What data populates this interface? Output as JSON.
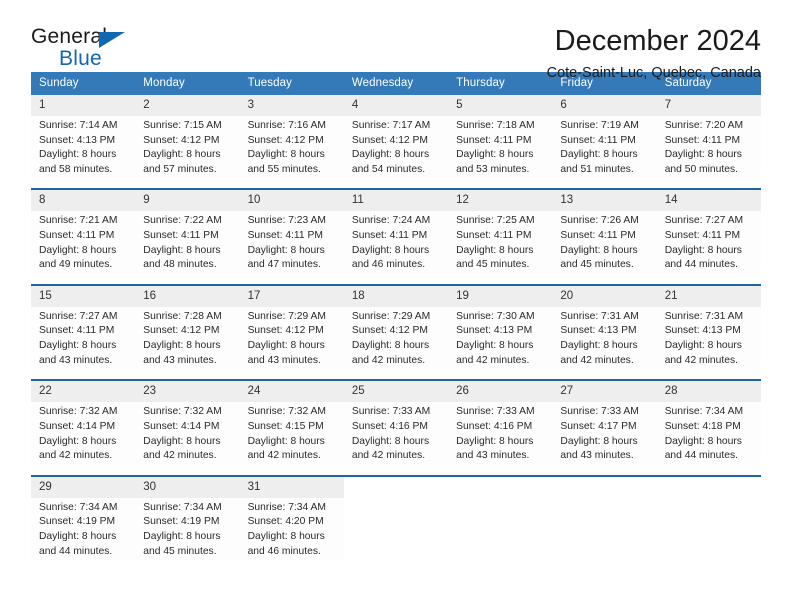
{
  "brand": {
    "word_one": "General",
    "word_two": "Blue",
    "triangle_icon": "triangle-icon"
  },
  "header": {
    "title": "December 2024",
    "location": "Cote-Saint-Luc, Quebec, Canada"
  },
  "colors": {
    "header_blue": "#3479b8",
    "separator_blue": "#1f64a5",
    "daynum_band": "#eeeeee",
    "brand_blue": "#1267b1",
    "text": "#222222"
  },
  "weekday_headers": [
    "Sunday",
    "Monday",
    "Tuesday",
    "Wednesday",
    "Thursday",
    "Friday",
    "Saturday"
  ],
  "weeks": [
    {
      "days": [
        {
          "date": "1",
          "sunrise": "Sunrise: 7:14 AM",
          "sunset": "Sunset: 4:13 PM",
          "daylight_1": "Daylight: 8 hours",
          "daylight_2": "and 58 minutes."
        },
        {
          "date": "2",
          "sunrise": "Sunrise: 7:15 AM",
          "sunset": "Sunset: 4:12 PM",
          "daylight_1": "Daylight: 8 hours",
          "daylight_2": "and 57 minutes."
        },
        {
          "date": "3",
          "sunrise": "Sunrise: 7:16 AM",
          "sunset": "Sunset: 4:12 PM",
          "daylight_1": "Daylight: 8 hours",
          "daylight_2": "and 55 minutes."
        },
        {
          "date": "4",
          "sunrise": "Sunrise: 7:17 AM",
          "sunset": "Sunset: 4:12 PM",
          "daylight_1": "Daylight: 8 hours",
          "daylight_2": "and 54 minutes."
        },
        {
          "date": "5",
          "sunrise": "Sunrise: 7:18 AM",
          "sunset": "Sunset: 4:11 PM",
          "daylight_1": "Daylight: 8 hours",
          "daylight_2": "and 53 minutes."
        },
        {
          "date": "6",
          "sunrise": "Sunrise: 7:19 AM",
          "sunset": "Sunset: 4:11 PM",
          "daylight_1": "Daylight: 8 hours",
          "daylight_2": "and 51 minutes."
        },
        {
          "date": "7",
          "sunrise": "Sunrise: 7:20 AM",
          "sunset": "Sunset: 4:11 PM",
          "daylight_1": "Daylight: 8 hours",
          "daylight_2": "and 50 minutes."
        }
      ]
    },
    {
      "days": [
        {
          "date": "8",
          "sunrise": "Sunrise: 7:21 AM",
          "sunset": "Sunset: 4:11 PM",
          "daylight_1": "Daylight: 8 hours",
          "daylight_2": "and 49 minutes."
        },
        {
          "date": "9",
          "sunrise": "Sunrise: 7:22 AM",
          "sunset": "Sunset: 4:11 PM",
          "daylight_1": "Daylight: 8 hours",
          "daylight_2": "and 48 minutes."
        },
        {
          "date": "10",
          "sunrise": "Sunrise: 7:23 AM",
          "sunset": "Sunset: 4:11 PM",
          "daylight_1": "Daylight: 8 hours",
          "daylight_2": "and 47 minutes."
        },
        {
          "date": "11",
          "sunrise": "Sunrise: 7:24 AM",
          "sunset": "Sunset: 4:11 PM",
          "daylight_1": "Daylight: 8 hours",
          "daylight_2": "and 46 minutes."
        },
        {
          "date": "12",
          "sunrise": "Sunrise: 7:25 AM",
          "sunset": "Sunset: 4:11 PM",
          "daylight_1": "Daylight: 8 hours",
          "daylight_2": "and 45 minutes."
        },
        {
          "date": "13",
          "sunrise": "Sunrise: 7:26 AM",
          "sunset": "Sunset: 4:11 PM",
          "daylight_1": "Daylight: 8 hours",
          "daylight_2": "and 45 minutes."
        },
        {
          "date": "14",
          "sunrise": "Sunrise: 7:27 AM",
          "sunset": "Sunset: 4:11 PM",
          "daylight_1": "Daylight: 8 hours",
          "daylight_2": "and 44 minutes."
        }
      ]
    },
    {
      "days": [
        {
          "date": "15",
          "sunrise": "Sunrise: 7:27 AM",
          "sunset": "Sunset: 4:11 PM",
          "daylight_1": "Daylight: 8 hours",
          "daylight_2": "and 43 minutes."
        },
        {
          "date": "16",
          "sunrise": "Sunrise: 7:28 AM",
          "sunset": "Sunset: 4:12 PM",
          "daylight_1": "Daylight: 8 hours",
          "daylight_2": "and 43 minutes."
        },
        {
          "date": "17",
          "sunrise": "Sunrise: 7:29 AM",
          "sunset": "Sunset: 4:12 PM",
          "daylight_1": "Daylight: 8 hours",
          "daylight_2": "and 43 minutes."
        },
        {
          "date": "18",
          "sunrise": "Sunrise: 7:29 AM",
          "sunset": "Sunset: 4:12 PM",
          "daylight_1": "Daylight: 8 hours",
          "daylight_2": "and 42 minutes."
        },
        {
          "date": "19",
          "sunrise": "Sunrise: 7:30 AM",
          "sunset": "Sunset: 4:13 PM",
          "daylight_1": "Daylight: 8 hours",
          "daylight_2": "and 42 minutes."
        },
        {
          "date": "20",
          "sunrise": "Sunrise: 7:31 AM",
          "sunset": "Sunset: 4:13 PM",
          "daylight_1": "Daylight: 8 hours",
          "daylight_2": "and 42 minutes."
        },
        {
          "date": "21",
          "sunrise": "Sunrise: 7:31 AM",
          "sunset": "Sunset: 4:13 PM",
          "daylight_1": "Daylight: 8 hours",
          "daylight_2": "and 42 minutes."
        }
      ]
    },
    {
      "days": [
        {
          "date": "22",
          "sunrise": "Sunrise: 7:32 AM",
          "sunset": "Sunset: 4:14 PM",
          "daylight_1": "Daylight: 8 hours",
          "daylight_2": "and 42 minutes."
        },
        {
          "date": "23",
          "sunrise": "Sunrise: 7:32 AM",
          "sunset": "Sunset: 4:14 PM",
          "daylight_1": "Daylight: 8 hours",
          "daylight_2": "and 42 minutes."
        },
        {
          "date": "24",
          "sunrise": "Sunrise: 7:32 AM",
          "sunset": "Sunset: 4:15 PM",
          "daylight_1": "Daylight: 8 hours",
          "daylight_2": "and 42 minutes."
        },
        {
          "date": "25",
          "sunrise": "Sunrise: 7:33 AM",
          "sunset": "Sunset: 4:16 PM",
          "daylight_1": "Daylight: 8 hours",
          "daylight_2": "and 42 minutes."
        },
        {
          "date": "26",
          "sunrise": "Sunrise: 7:33 AM",
          "sunset": "Sunset: 4:16 PM",
          "daylight_1": "Daylight: 8 hours",
          "daylight_2": "and 43 minutes."
        },
        {
          "date": "27",
          "sunrise": "Sunrise: 7:33 AM",
          "sunset": "Sunset: 4:17 PM",
          "daylight_1": "Daylight: 8 hours",
          "daylight_2": "and 43 minutes."
        },
        {
          "date": "28",
          "sunrise": "Sunrise: 7:34 AM",
          "sunset": "Sunset: 4:18 PM",
          "daylight_1": "Daylight: 8 hours",
          "daylight_2": "and 44 minutes."
        }
      ]
    },
    {
      "days": [
        {
          "date": "29",
          "sunrise": "Sunrise: 7:34 AM",
          "sunset": "Sunset: 4:19 PM",
          "daylight_1": "Daylight: 8 hours",
          "daylight_2": "and 44 minutes."
        },
        {
          "date": "30",
          "sunrise": "Sunrise: 7:34 AM",
          "sunset": "Sunset: 4:19 PM",
          "daylight_1": "Daylight: 8 hours",
          "daylight_2": "and 45 minutes."
        },
        {
          "date": "31",
          "sunrise": "Sunrise: 7:34 AM",
          "sunset": "Sunset: 4:20 PM",
          "daylight_1": "Daylight: 8 hours",
          "daylight_2": "and 46 minutes."
        },
        {
          "date": "",
          "sunrise": "",
          "sunset": "",
          "daylight_1": "",
          "daylight_2": ""
        },
        {
          "date": "",
          "sunrise": "",
          "sunset": "",
          "daylight_1": "",
          "daylight_2": ""
        },
        {
          "date": "",
          "sunrise": "",
          "sunset": "",
          "daylight_1": "",
          "daylight_2": ""
        },
        {
          "date": "",
          "sunrise": "",
          "sunset": "",
          "daylight_1": "",
          "daylight_2": ""
        }
      ]
    }
  ]
}
